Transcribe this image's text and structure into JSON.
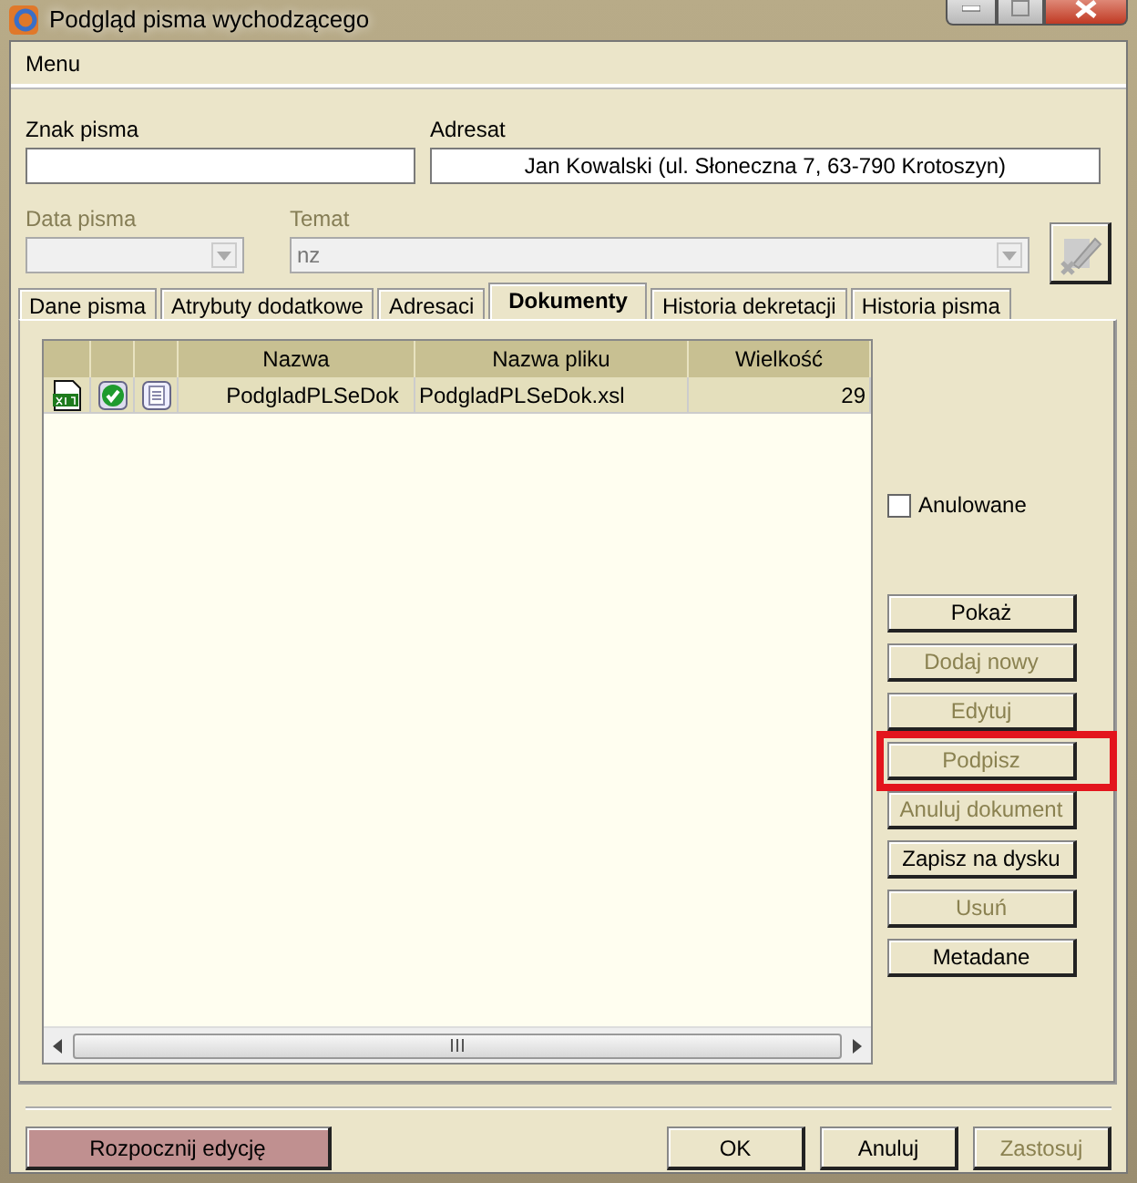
{
  "window": {
    "title": "Podgląd pisma wychodzącego"
  },
  "menu": [
    "Menu"
  ],
  "fields": [
    {
      "label": "Znak pisma",
      "kind": "text",
      "disabled": false
    },
    {
      "label": "Adresat",
      "value": "Jan Kowalski (ul. Słoneczna 7, 63-790 Krotoszyn)",
      "kind": "text",
      "disabled": false
    },
    {
      "label": "Data pisma",
      "kind": "combo",
      "disabled": true
    },
    {
      "label": "Temat",
      "value": "nz",
      "kind": "combo",
      "disabled": true
    }
  ],
  "tabs": [
    {
      "label": "Dane pisma",
      "selected": false
    },
    {
      "label": "Atrybuty dodatkowe",
      "selected": false
    },
    {
      "label": "Adresaci",
      "selected": false
    },
    {
      "label": "Dokumenty",
      "selected": true
    },
    {
      "label": "Historia dekretacji",
      "selected": false
    },
    {
      "label": "Historia pisma",
      "selected": false
    }
  ],
  "table": {
    "columns": [
      "Nazwa",
      "Nazwa pliku",
      "Wielkość"
    ],
    "rows": [
      {
        "name": "PodgladPLSeDok",
        "file": "PodgladPLSeDok.xsl",
        "size": "29",
        "selected": true
      }
    ]
  },
  "anulowane": {
    "label": "Anulowane",
    "checked": false
  },
  "doc_buttons": [
    {
      "label": "Pokaż",
      "disabled": false,
      "highlighted": false
    },
    {
      "label": "Dodaj nowy",
      "disabled": true,
      "highlighted": false
    },
    {
      "label": "Edytuj",
      "disabled": true,
      "highlighted": false
    },
    {
      "label": "Podpisz",
      "disabled": true,
      "highlighted": true
    },
    {
      "label": "Anuluj dokument",
      "disabled": true,
      "highlighted": false
    },
    {
      "label": "Zapisz na dysku",
      "disabled": false,
      "highlighted": false
    },
    {
      "label": "Usuń",
      "disabled": true,
      "highlighted": false
    },
    {
      "label": "Metadane",
      "disabled": false,
      "highlighted": false
    }
  ],
  "edit_button": {
    "label": "Rozpocznij edycję"
  },
  "buttons": [
    {
      "label": "OK",
      "disabled": false
    },
    {
      "label": "Anuluj",
      "disabled": false
    },
    {
      "label": "Zastosuj",
      "disabled": true
    }
  ]
}
